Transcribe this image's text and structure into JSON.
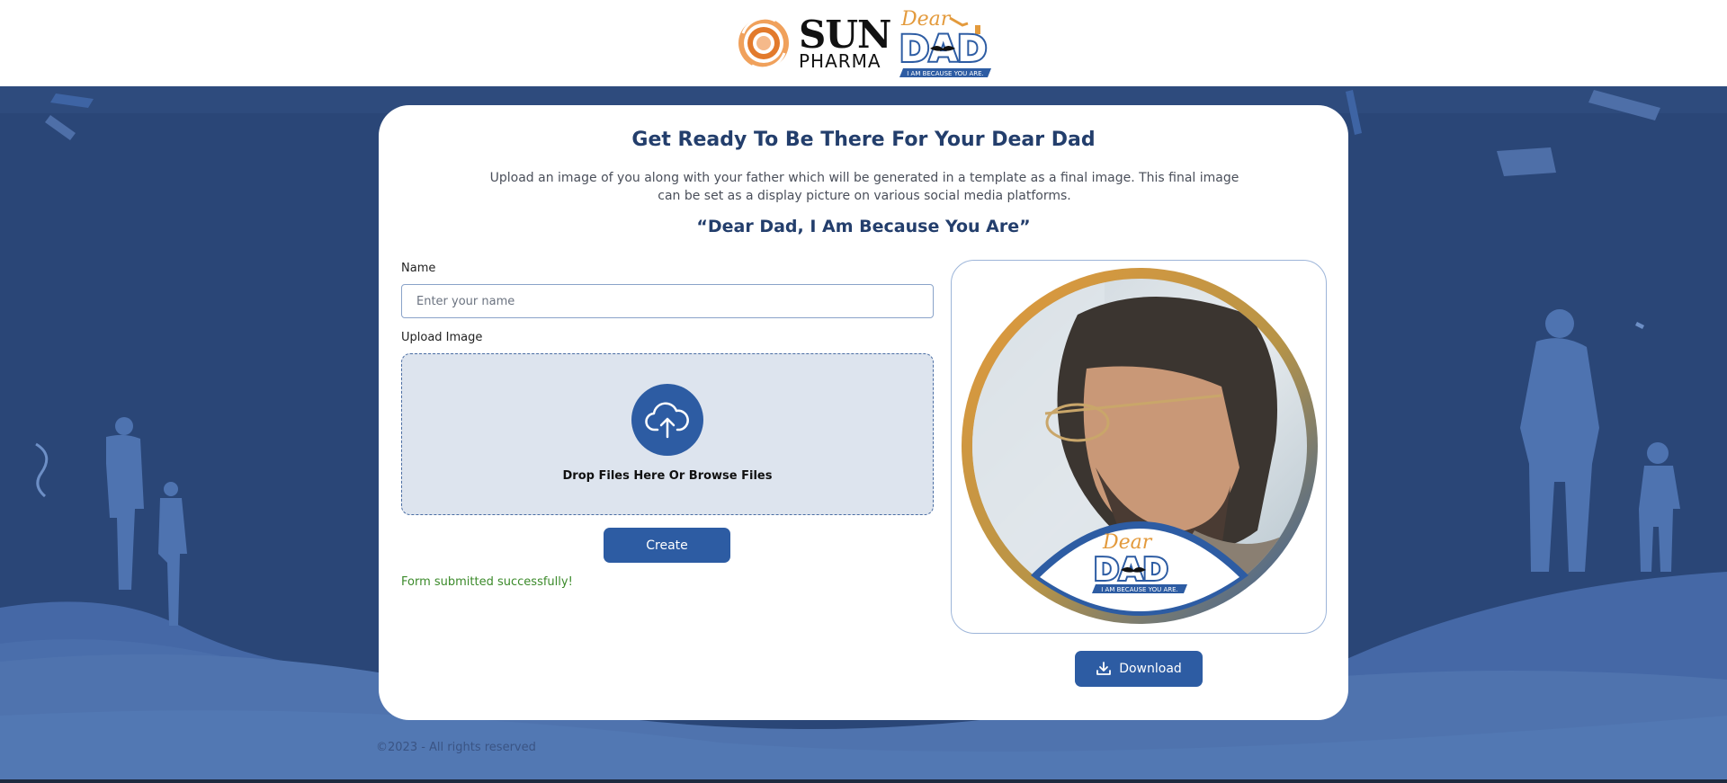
{
  "header": {
    "brand_top": "SUN",
    "brand_bottom": "PHARMA",
    "campaign_logo_word1": "Dear",
    "campaign_logo_word2": "DAD",
    "campaign_logo_tagline": "I AM BECAUSE YOU ARE."
  },
  "card": {
    "title": "Get Ready To Be There For Your Dear Dad",
    "description": "Upload an image of you along with your father which will be generated in a template as a final image. This final image can be set as a display picture on various social media platforms.",
    "quote": "“Dear Dad, I Am Because You Are”"
  },
  "form": {
    "name_label": "Name",
    "name_placeholder": "Enter your name",
    "name_value": "",
    "upload_label": "Upload Image",
    "drop_text": "Drop Files Here Or Browse Files",
    "create_label": "Create",
    "success_message": "Form submitted successfully!"
  },
  "preview": {
    "overlay_word1": "Dear",
    "overlay_word2": "DAD",
    "overlay_tagline": "I AM BECAUSE YOU ARE.",
    "download_label": "Download"
  },
  "footer": {
    "text": "©2023 - All rights reserved"
  },
  "colors": {
    "brand_blue": "#2d5ca3",
    "heading_navy": "#233e6c",
    "background": "#2a4677",
    "accent_orange": "#e39a3c",
    "success_green": "#3b8a2a"
  },
  "icons": {
    "upload": "cloud-upload-icon",
    "download": "download-icon"
  }
}
